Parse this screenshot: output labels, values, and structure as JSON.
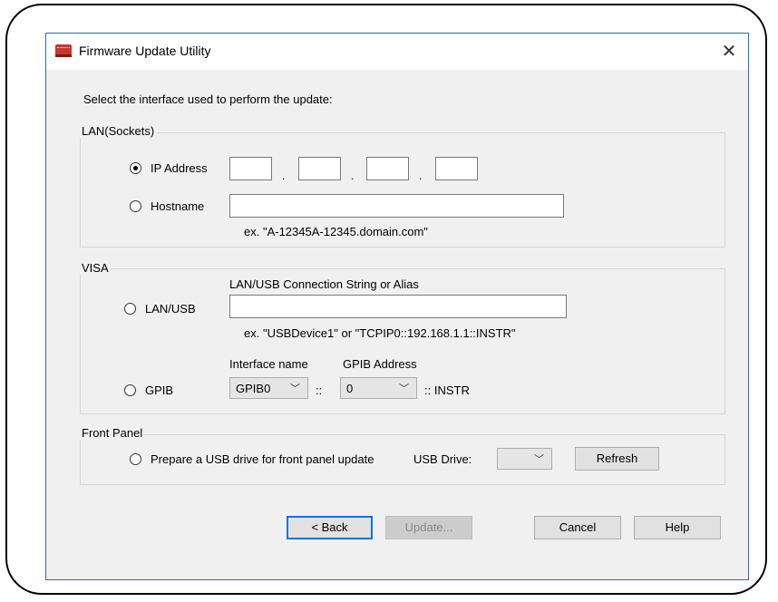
{
  "window": {
    "title": "Firmware Update Utility"
  },
  "intro": "Select the interface used to perform the update:",
  "lan": {
    "group_label": "LAN(Sockets)",
    "ip_label": "IP Address",
    "ip_separator": ".",
    "hostname_label": "Hostname",
    "hostname_hint": "ex. \"A-12345A-12345.domain.com\""
  },
  "visa": {
    "group_label": "VISA",
    "conn_label": "LAN/USB Connection String or Alias",
    "lanusb_label": "LAN/USB",
    "conn_hint": "ex. \"USBDevice1\" or \"TCPIP0::192.168.1.1::INSTR\"",
    "gpib_label": "GPIB",
    "iface_name_label": "Interface name",
    "gpib_addr_label": "GPIB Address",
    "iface_value": "GPIB0",
    "separator": "::",
    "addr_value": "0",
    "suffix": ":: INSTR"
  },
  "front_panel": {
    "group_label": "Front Panel",
    "prepare_label": "Prepare a USB drive for front panel update",
    "usb_drive_label": "USB Drive:",
    "usb_drive_value": "",
    "refresh_label": "Refresh"
  },
  "buttons": {
    "back": "< Back",
    "update": "Update...",
    "cancel": "Cancel",
    "help": "Help"
  },
  "colors": {
    "accent": "#0078d7",
    "window_bg": "#f0f0f0",
    "icon_red": "#c8372f"
  }
}
